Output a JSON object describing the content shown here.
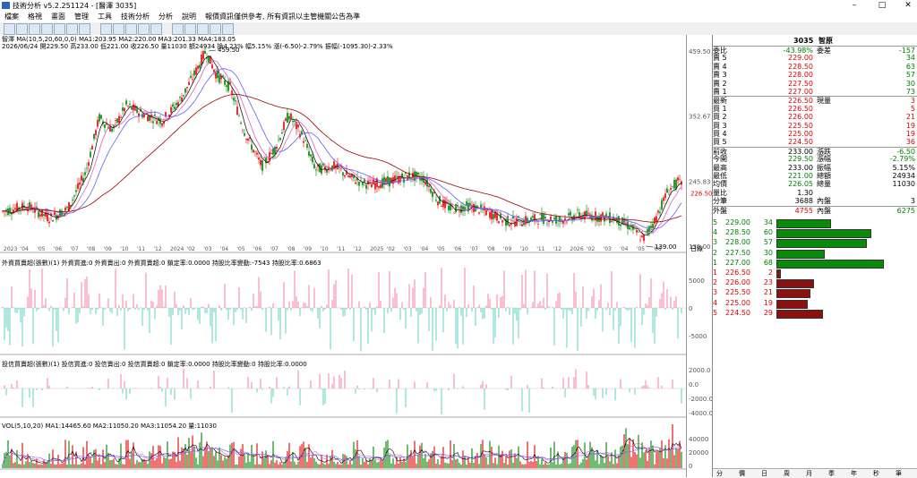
{
  "window": {
    "title": "技術分析 v5.2.251124 - [醫澤 3035]",
    "min": "–",
    "max": "□",
    "close": "✕"
  },
  "menu": [
    "檔案",
    "格視",
    "畫面",
    "管理",
    "工具",
    "技術分析",
    "分析",
    "說明",
    "報價資訊僅供參考, 所有資訊以主管機關公告為準"
  ],
  "toolbar_icons": [
    "add-icon",
    "cross-icon",
    "grid-icon",
    "chart-icon",
    "bar-icon",
    "candle-icon",
    "line-icon",
    "zoom-icon",
    "window-icon",
    "pen-icon",
    "line-tool-icon",
    "ray-icon",
    "arrow-icon",
    "circle-icon",
    "text-icon",
    "color-icon",
    "save-icon"
  ],
  "main": {
    "line1": "智澤 MA(10,5,20,60,0,0) MA1:203.95 MA2:220.00 MA3:201.33 MA4:183.05",
    "line2": "2026/06/24 開229.50 高233.00 低221.00 收226.50 量11030 額24934 換4.23% 幅5.15% 漲(-6.50)-2.79% 振幅(-1095.30)-2.33%",
    "high_label": "459.50",
    "low_label": "139.00",
    "price_axis": [
      "459.50",
      "352.67",
      "245.83",
      "139.00"
    ],
    "current_price": "226.50",
    "x_axis": [
      "2023",
      "'04",
      "'05",
      "'06",
      "'07",
      "'08",
      "'09",
      "'10",
      "'11",
      "'12",
      "2024",
      "'02",
      "'03",
      "'04",
      "'05",
      "'06",
      "'07",
      "'08",
      "'09",
      "'10",
      "'11",
      "'12",
      "2025",
      "'02",
      "'03",
      "'04",
      "'05",
      "'06",
      "'07",
      "'08",
      "'09",
      "'10",
      "'11",
      "'12",
      "2026",
      "'02",
      "'03",
      "'04",
      "'05",
      "'06"
    ],
    "x_axis_end": "日線"
  },
  "foreign": {
    "legend": "外資買賣超(張數)(1) 外資買進:0 外資賣出:0 外資買賣超:0 鎖定率:0.0000 持股比率變動:-7543 持股比率:0.6863",
    "axis": [
      "5000",
      "0",
      "-5000"
    ]
  },
  "trust": {
    "legend": "投信買賣超(張數)(1) 投信買進:0 投信賣出:0 投信買賣超:0 鎖定率:0.0000 持股比率變動:0 持股比率:0.0000",
    "axis": [
      "2000.0",
      "0.0",
      "-2000.0",
      "-4000.0"
    ]
  },
  "volume": {
    "legend": "VOL(5,10,20) MA1:14465.60 MA2:11050.20 MA3:11054.20 量:11030",
    "axis": [
      "40000",
      "20000",
      "0"
    ]
  },
  "quote": {
    "code": "3035",
    "name": "智原",
    "rows": [
      {
        "l": "委比",
        "v": "-43.98%",
        "l2": "委差",
        "v2": "-157",
        "c": "green",
        "c2": "green"
      },
      {
        "l": "賣 5",
        "v": "229.00",
        "v2": "34",
        "c": "red",
        "c2": "green"
      },
      {
        "l": "賣 4",
        "v": "228.50",
        "v2": "63",
        "c": "red",
        "c2": "green"
      },
      {
        "l": "賣 3",
        "v": "228.00",
        "v2": "57",
        "c": "red",
        "c2": "green"
      },
      {
        "l": "賣 2",
        "v": "227.50",
        "v2": "30",
        "c": "red",
        "c2": "green"
      },
      {
        "l": "賣 1",
        "v": "227.00",
        "v2": "73",
        "c": "red",
        "c2": "green"
      },
      {
        "l": "最新",
        "v": "226.50",
        "l2": "現量",
        "v2": "3",
        "c": "red",
        "c2": "red"
      },
      {
        "l": "買 1",
        "v": "226.50",
        "v2": "5",
        "c": "red",
        "c2": "red"
      },
      {
        "l": "買 2",
        "v": "226.00",
        "v2": "21",
        "c": "red",
        "c2": "red"
      },
      {
        "l": "買 3",
        "v": "225.50",
        "v2": "19",
        "c": "red",
        "c2": "red"
      },
      {
        "l": "買 4",
        "v": "225.00",
        "v2": "19",
        "c": "red",
        "c2": "red"
      },
      {
        "l": "買 5",
        "v": "224.50",
        "v2": "36",
        "c": "red",
        "c2": "red"
      },
      {
        "l": "前收",
        "v": "233.00",
        "l2": "漲跌",
        "v2": "-6.50",
        "c": "",
        "c2": "green"
      },
      {
        "l": "今開",
        "v": "229.50",
        "l2": "漲幅",
        "v2": "-2.79%",
        "c": "green",
        "c2": "green"
      },
      {
        "l": "最高",
        "v": "233.00",
        "l2": "振幅",
        "v2": "5.15%",
        "c": "",
        "c2": ""
      },
      {
        "l": "最低",
        "v": "221.00",
        "l2": "總額",
        "v2": "24934",
        "c": "green",
        "c2": ""
      },
      {
        "l": "均價",
        "v": "226.05",
        "l2": "總量",
        "v2": "11030",
        "c": "green",
        "c2": ""
      },
      {
        "l": "量比",
        "v": "1.30",
        "l2": "",
        "v2": "",
        "c": "",
        "c2": ""
      },
      {
        "l": "分筆",
        "v": "3688",
        "l2": "內盤",
        "v2": "3",
        "c": "",
        "c2": ""
      },
      {
        "l": "外盤",
        "v": "4755",
        "l2": "內盤",
        "v2": "6275",
        "c": "red",
        "c2": "green"
      }
    ],
    "ladder": [
      {
        "lvl": "5",
        "price": "229.00",
        "qty": "34",
        "bar": 34,
        "color": "#0a8a0a",
        "pc": "green"
      },
      {
        "lvl": "4",
        "price": "228.50",
        "qty": "60",
        "bar": 60,
        "color": "#0a8a0a",
        "pc": "green"
      },
      {
        "lvl": "3",
        "price": "228.00",
        "qty": "57",
        "bar": 57,
        "color": "#0a8a0a",
        "pc": "green"
      },
      {
        "lvl": "2",
        "price": "227.50",
        "qty": "30",
        "bar": 30,
        "color": "#0a8a0a",
        "pc": "green"
      },
      {
        "lvl": "1",
        "price": "227.00",
        "qty": "68",
        "bar": 68,
        "color": "#0a8a0a",
        "pc": "green"
      },
      {
        "lvl": "1",
        "price": "226.50",
        "qty": "2",
        "bar": 2,
        "color": "#8b1010",
        "pc": "red"
      },
      {
        "lvl": "2",
        "price": "226.00",
        "qty": "23",
        "bar": 23,
        "color": "#8b1010",
        "pc": "red"
      },
      {
        "lvl": "3",
        "price": "225.50",
        "qty": "21",
        "bar": 21,
        "color": "#8b1010",
        "pc": "red"
      },
      {
        "lvl": "4",
        "price": "225.00",
        "qty": "19",
        "bar": 19,
        "color": "#8b1010",
        "pc": "red"
      },
      {
        "lvl": "5",
        "price": "224.50",
        "qty": "29",
        "bar": 29,
        "color": "#8b1010",
        "pc": "red"
      }
    ],
    "tabs": [
      "分",
      "價",
      "日",
      "周",
      "月",
      "季",
      "年",
      "秒",
      "筆"
    ]
  },
  "chart_data": {
    "type": "candlestick",
    "price_range": [
      139.0,
      459.5
    ],
    "series": [
      {
        "name": "MA1",
        "color": "#1a1a1a"
      },
      {
        "name": "MA2",
        "color": "#e060c0"
      },
      {
        "name": "MA3",
        "color": "#6060ff"
      },
      {
        "name": "MA4",
        "color": "#a00000"
      }
    ],
    "high": 459.5,
    "low": 139.0,
    "last": 226.5
  },
  "colors": {
    "up": "#e00000",
    "down": "#008000",
    "foreign_up": "#f080a0",
    "foreign_down": "#60d0c0"
  }
}
